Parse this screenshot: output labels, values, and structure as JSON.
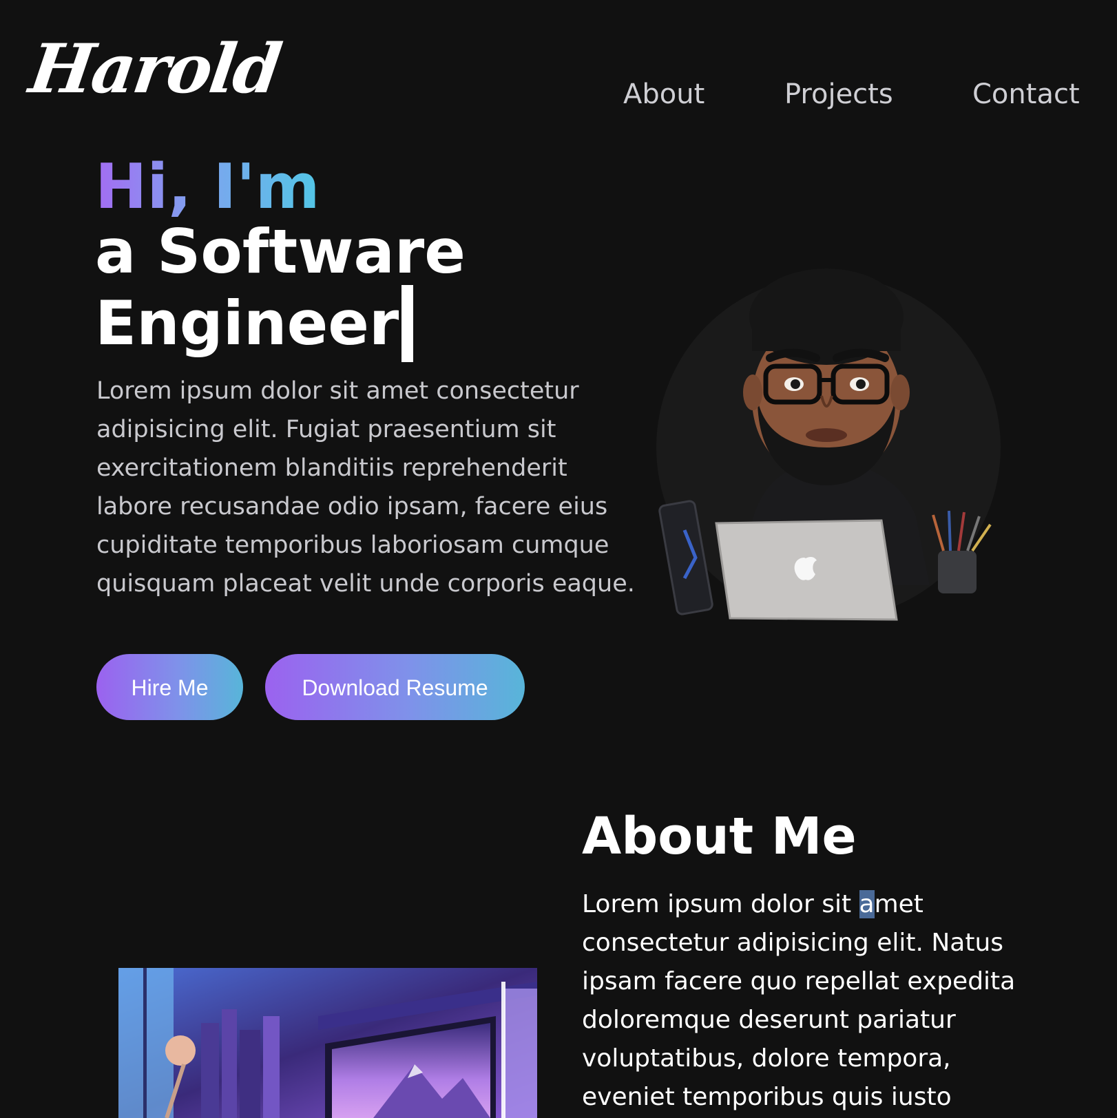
{
  "header": {
    "logo_text": "Harold",
    "nav": [
      {
        "label": "About"
      },
      {
        "label": "Projects"
      },
      {
        "label": "Contact"
      }
    ]
  },
  "hero": {
    "greeting": "Hi, I'm",
    "title_line1": "a Software",
    "title_line2": "Engineer",
    "description": "Lorem ipsum dolor sit amet consectetur adipisicing elit. Fugiat praesentium sit exercitationem blanditiis reprehenderit labore recusandae odio ipsam, facere eius cupiditate temporibus laboriosam cumque quisquam placeat velit unde corporis eaque.",
    "hire_button": "Hire Me",
    "resume_button": "Download Resume"
  },
  "about": {
    "title": "About Me",
    "text_before": "Lorem ipsum dolor sit ",
    "text_selected": "a",
    "text_after": "met consectetur adipisicing elit. Natus ipsam facere quo repellat expedita doloremque deserunt pariatur voluptatibus, dolore tempora, eveniet temporibus quis iusto"
  },
  "colors": {
    "background": "#111111",
    "gradient_start": "#9b62ef",
    "gradient_end": "#58b5d9",
    "nav_text": "#cfcfd4",
    "body_text": "#c9c9ce"
  }
}
